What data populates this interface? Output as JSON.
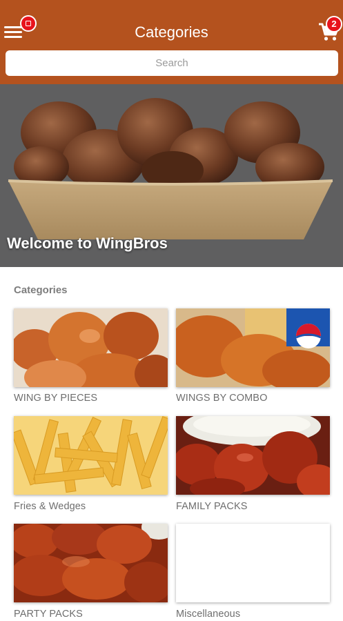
{
  "appbar": {
    "title": "Categories",
    "cart_count": "2",
    "menu_icon": "hamburger-icon",
    "cart_icon": "shopping-cart-icon",
    "color": "#b4521e",
    "badge_color": "#e8131c"
  },
  "search": {
    "placeholder": "Search"
  },
  "hero": {
    "title": "Welcome to WingBros"
  },
  "categories": {
    "heading": "Categories",
    "items": [
      {
        "label": "WING BY PIECES"
      },
      {
        "label": "WINGS BY COMBO"
      },
      {
        "label": "Fries & Wedges"
      },
      {
        "label": "FAMILY PACKS"
      },
      {
        "label": "PARTY PACKS"
      },
      {
        "label": "Miscellaneous"
      }
    ]
  }
}
